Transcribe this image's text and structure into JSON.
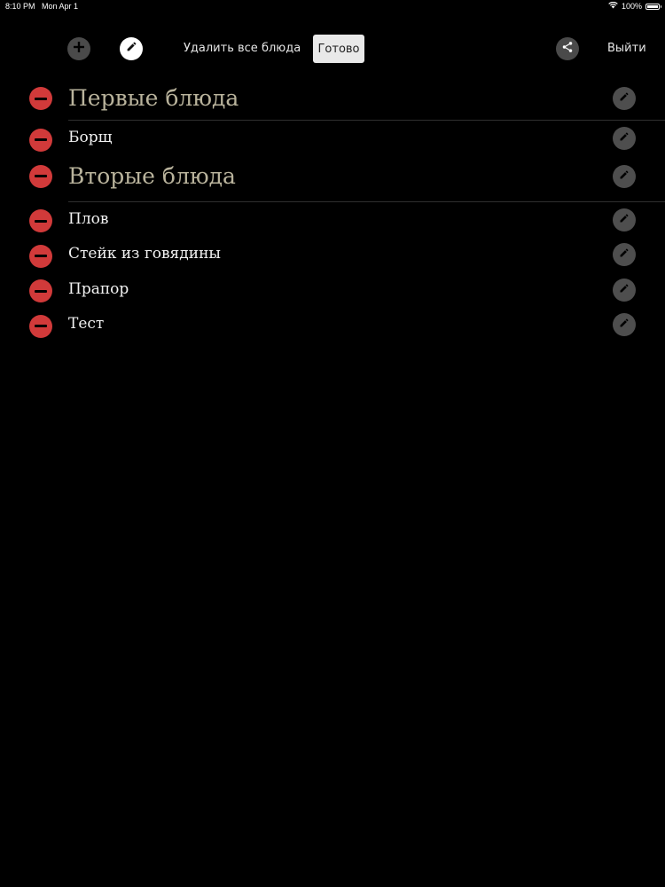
{
  "status_bar": {
    "time": "8:10 PM",
    "date": "Mon Apr 1",
    "battery_text": "100%",
    "battery_level": 1.0
  },
  "toolbar": {
    "add_icon": "plus-icon",
    "edit_icon": "pencil-icon",
    "delete_all_label": "Удалить все блюда",
    "done_label": "Готово",
    "share_icon": "share-icon",
    "logout_label": "Выйти"
  },
  "colors": {
    "background": "#000000",
    "category_text": "#b9b39c",
    "dish_text": "#f2f2f2",
    "delete_red": "#d13a3a",
    "icon_button_bg": "#4e4e4e",
    "done_button_bg": "#e9e9e9"
  },
  "list": {
    "rows": [
      {
        "type": "category",
        "label": "Первые блюда"
      },
      {
        "type": "dish",
        "label": "Борщ"
      },
      {
        "type": "category",
        "label": "Вторые блюда"
      },
      {
        "type": "dish",
        "label": "Плов"
      },
      {
        "type": "dish",
        "label": "Стейк из говядины"
      },
      {
        "type": "dish",
        "label": "Прапор"
      },
      {
        "type": "dish",
        "label": "Тест"
      }
    ]
  }
}
